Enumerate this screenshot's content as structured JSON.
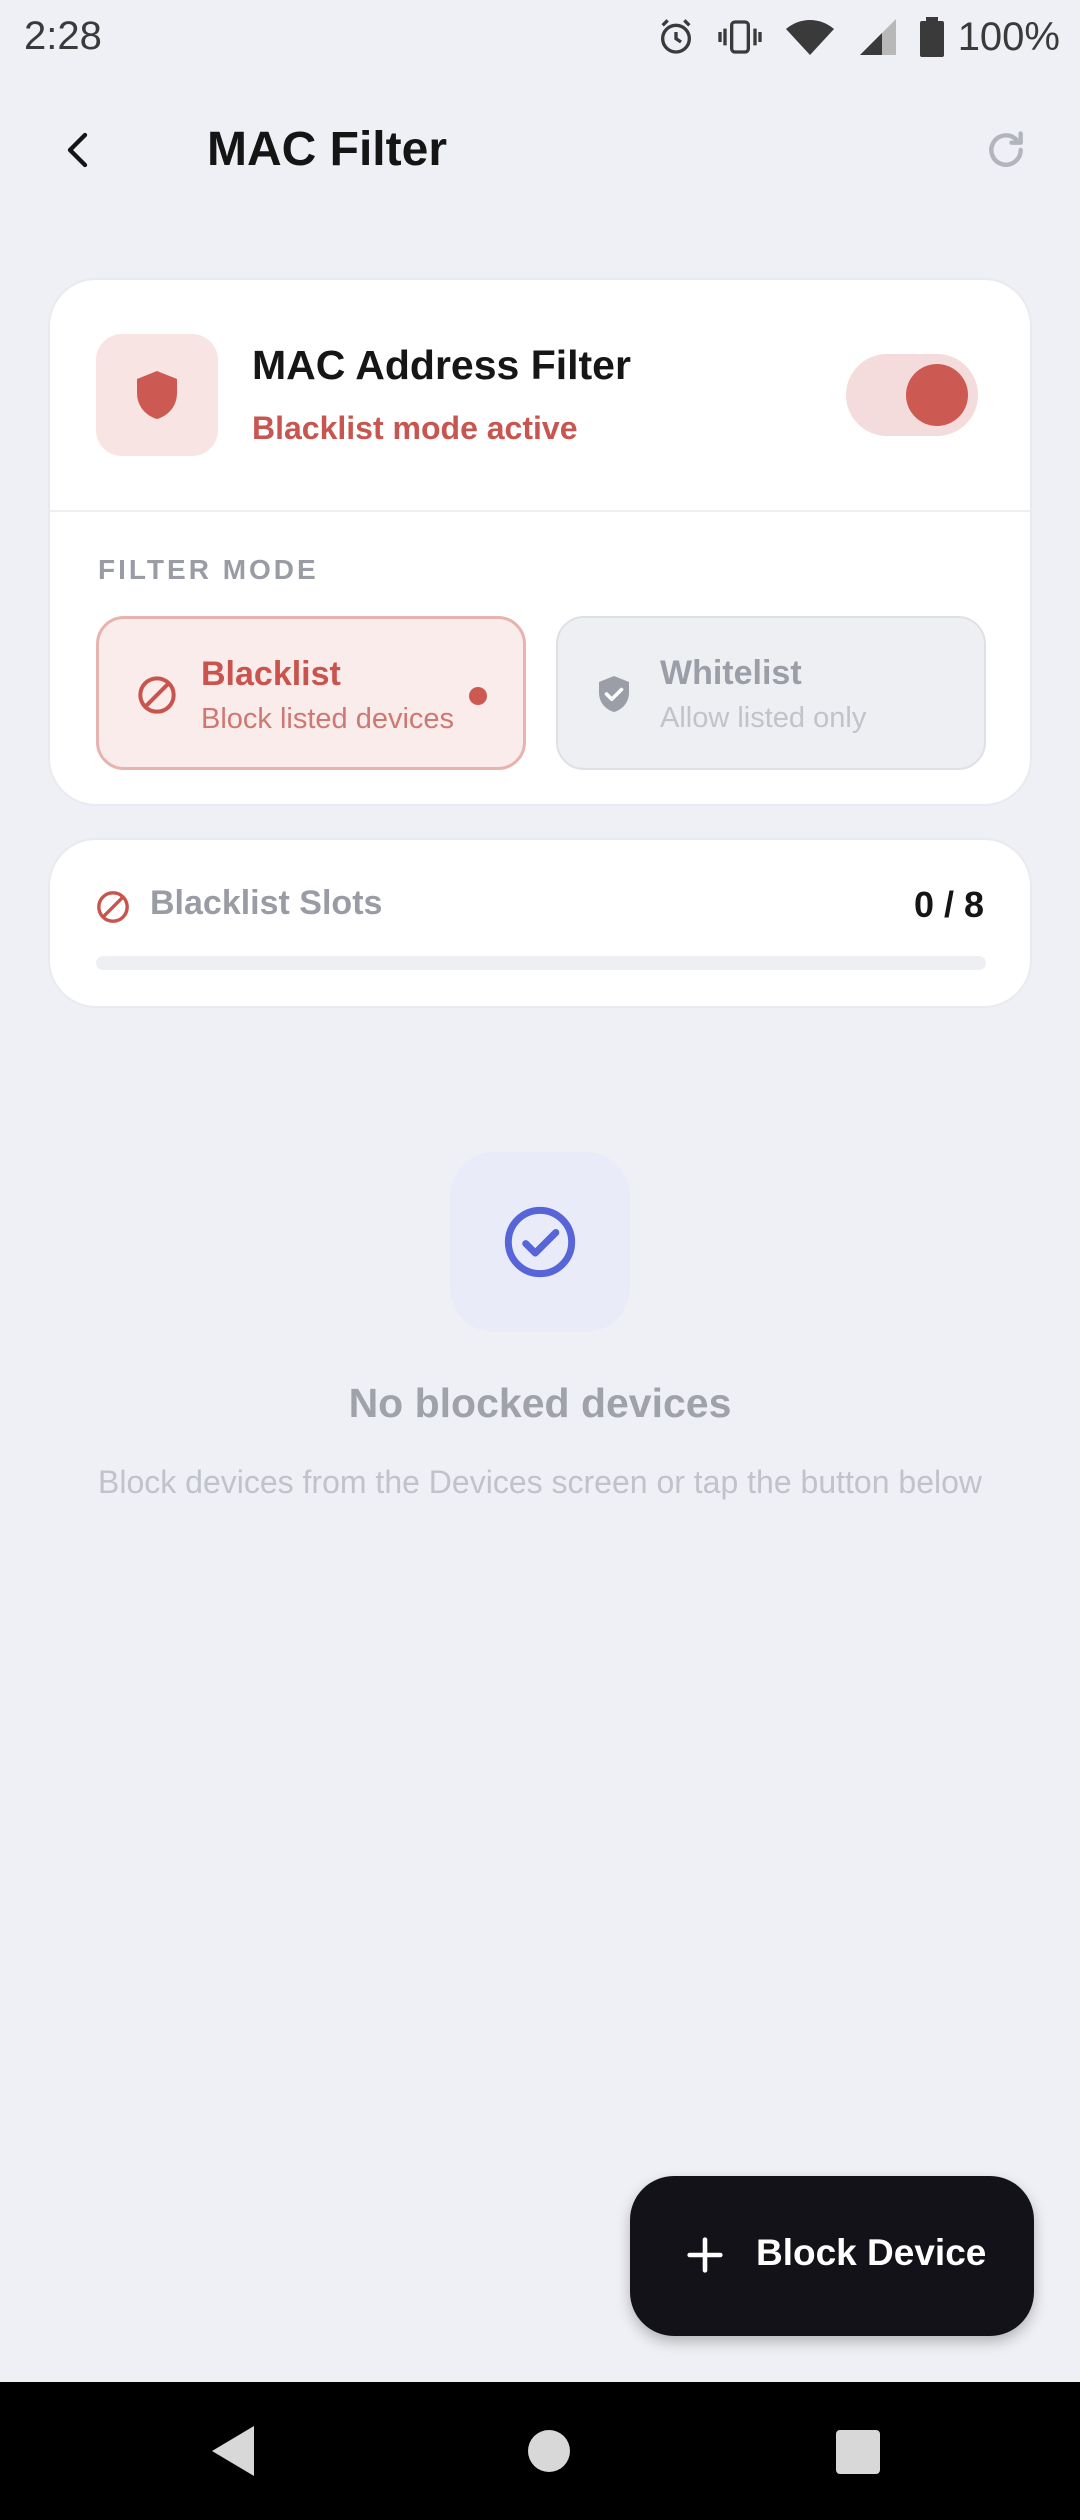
{
  "status_bar": {
    "time": "2:28",
    "battery_text": "100%",
    "icons": [
      "alarm-icon",
      "vibrate-icon",
      "wifi-icon",
      "signal-icon",
      "battery-icon"
    ]
  },
  "app_bar": {
    "title": "MAC Filter",
    "back_icon": "chevron-left-icon",
    "refresh_icon": "refresh-icon"
  },
  "filter_card": {
    "title": "MAC Address Filter",
    "subtitle": "Blacklist mode active",
    "enabled": true,
    "mode_section_label": "FILTER MODE",
    "modes": [
      {
        "label": "Blacklist",
        "description": "Block listed devices",
        "selected": true,
        "icon": "block-icon"
      },
      {
        "label": "Whitelist",
        "description": "Allow listed only",
        "selected": false,
        "icon": "shield-check-icon"
      }
    ]
  },
  "slots_card": {
    "label": "Blacklist Slots",
    "count": "0 / 8",
    "used": 0,
    "total": 8
  },
  "empty_state": {
    "title": "No blocked devices",
    "description": "Block devices from the Devices screen or tap the button below"
  },
  "fab": {
    "label": "Block Device",
    "icon": "plus-icon"
  },
  "colors": {
    "accent": "#cc5a52",
    "accent_light": "#f8e4e3",
    "background": "#eff0f5",
    "empty_icon": "#5865d8"
  }
}
